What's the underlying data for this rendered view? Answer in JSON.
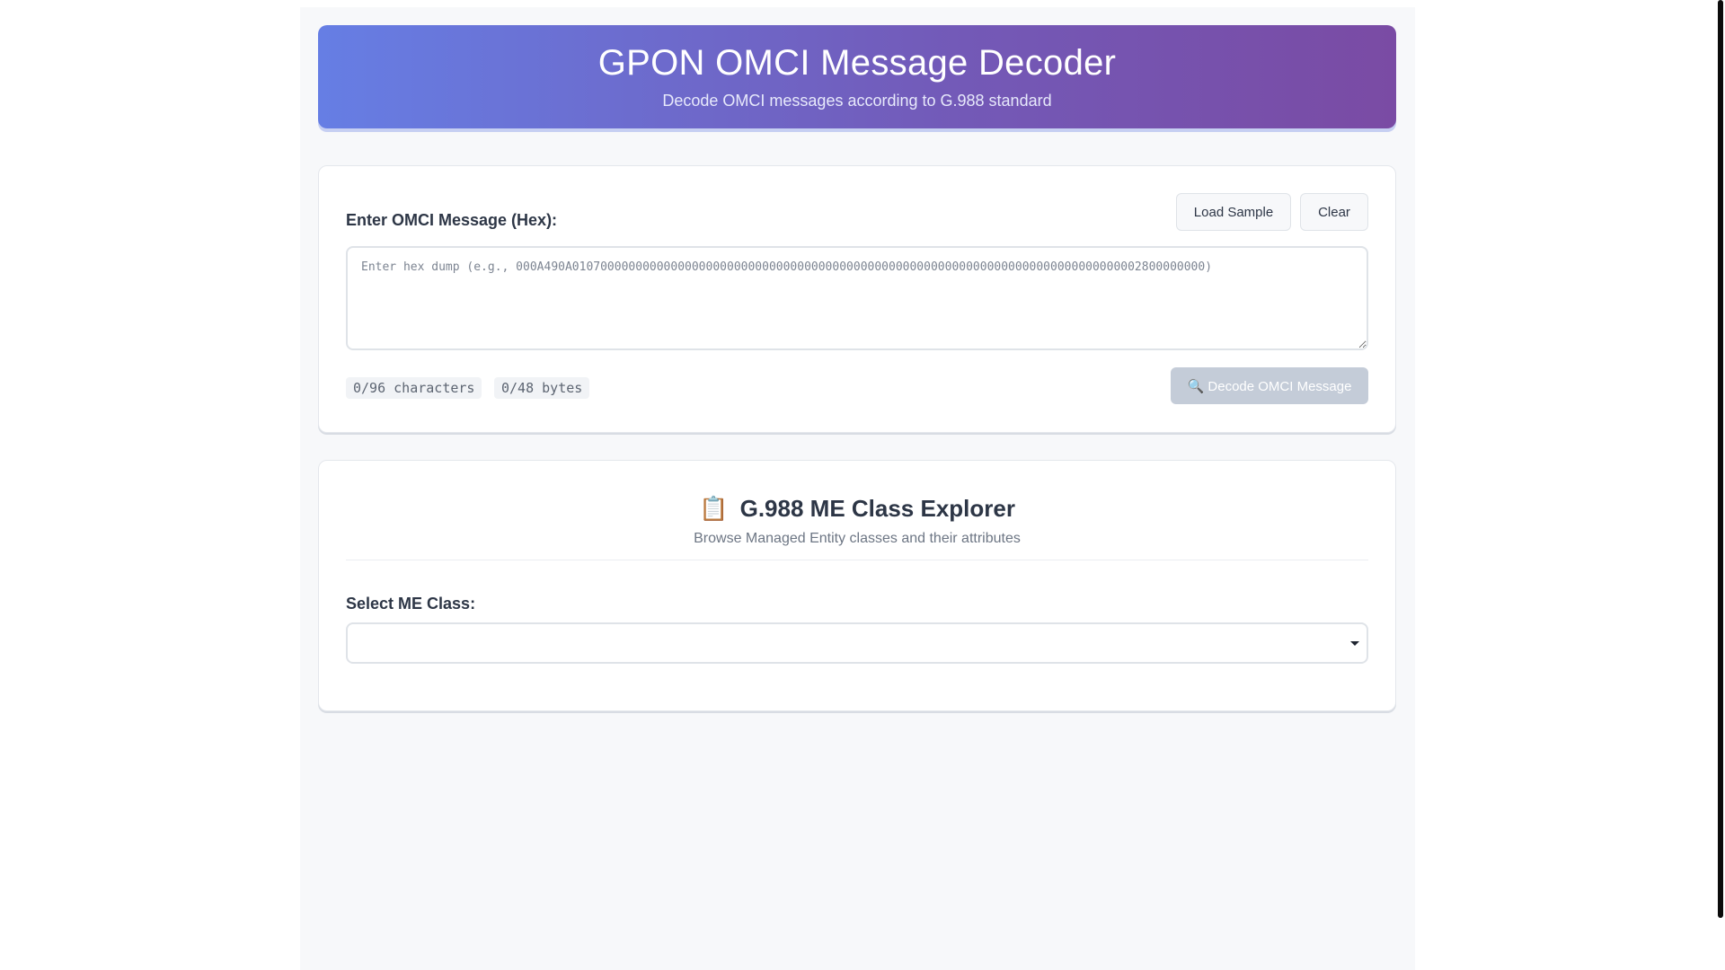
{
  "header": {
    "title": "GPON OMCI Message Decoder",
    "subtitle": "Decode OMCI messages according to G.988 standard"
  },
  "input_section": {
    "label": "Enter OMCI Message (Hex):",
    "load_sample_label": "Load Sample",
    "clear_label": "Clear",
    "hex_value": "",
    "hex_placeholder": "Enter hex dump (e.g., 000A490A010700000000000000000000000000000000000000000000000000000000000000000000000000002800000000)",
    "char_count": "0/96 characters",
    "byte_count": "0/48 bytes",
    "decode_button": {
      "icon": "magnifier-icon",
      "glyph": "🔍",
      "label": "Decode OMCI Message",
      "enabled": false
    }
  },
  "explorer": {
    "icon": "clipboard-icon",
    "icon_glyph": "📋",
    "title": "G.988 ME Class Explorer",
    "subtitle": "Browse Managed Entity classes and their attributes",
    "select_label": "Select ME Class:",
    "selected_value": ""
  },
  "colors": {
    "header_gradient_start": "#667ee4",
    "header_gradient_end": "#7a4ba4",
    "decode_disabled_bg": "#c4ccd8",
    "page_bg": "#f7f8fa"
  }
}
